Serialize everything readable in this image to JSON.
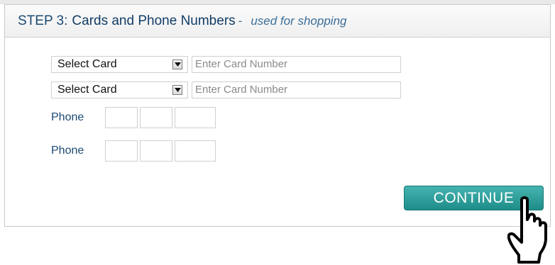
{
  "step": {
    "prefix": "STEP 3:",
    "title": "Cards and Phone Numbers",
    "separator": "-",
    "subtitle": "used for shopping"
  },
  "cards": [
    {
      "select_value": "Select Card",
      "placeholder": "Enter Card Number"
    },
    {
      "select_value": "Select Card",
      "placeholder": "Enter Card Number"
    }
  ],
  "phones": [
    {
      "label": "Phone"
    },
    {
      "label": "Phone"
    }
  ],
  "continue_label": "CONTINUE",
  "colors": {
    "heading": "#1c4a73",
    "button": "#2a9e9a",
    "border": "#cfcfcf"
  },
  "icons": [
    "dropdown-arrow-icon",
    "pointing-hand-cursor-icon"
  ]
}
